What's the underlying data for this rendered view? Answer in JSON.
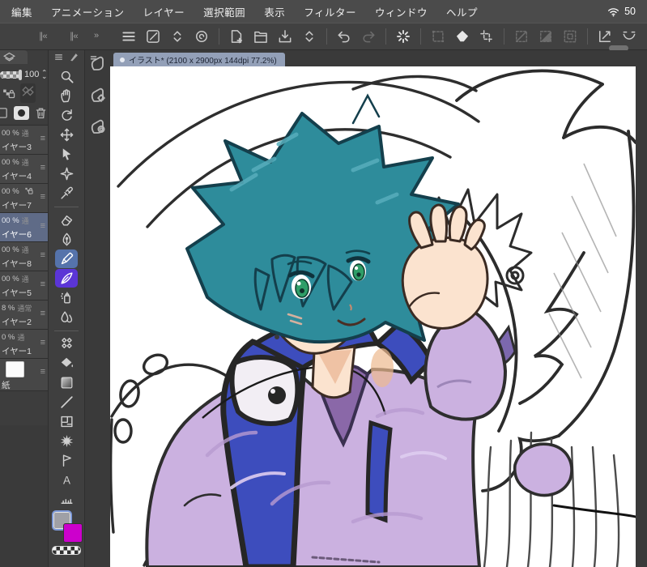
{
  "status": {
    "battery": "50"
  },
  "menu": {
    "items": [
      "編集",
      "アニメーション",
      "レイヤー",
      "選択範囲",
      "表示",
      "フィルター",
      "ウィンドウ",
      "ヘルプ"
    ]
  },
  "toolbar": {
    "collapse_left": "∥«",
    "collapse_mid": "∥«",
    "collapse_right": "»",
    "groups": [
      {
        "icons": [
          {
            "n": "main-menu"
          },
          {
            "n": "pen-settings"
          },
          {
            "n": "expand-chevrons"
          },
          {
            "n": "clip-studio"
          }
        ]
      },
      {
        "icons": [
          {
            "n": "new-canvas"
          },
          {
            "n": "open-file"
          },
          {
            "n": "save-file"
          },
          {
            "n": "expand-chevrons"
          }
        ]
      },
      {
        "icons": [
          {
            "n": "undo"
          },
          {
            "n": "redo",
            "disabled": true
          }
        ]
      },
      {
        "icons": [
          {
            "n": "sparkle",
            "bright": true
          }
        ]
      },
      {
        "icons": [
          {
            "n": "select-launcher",
            "disabled": true
          },
          {
            "n": "erase-diamond",
            "bright": true
          },
          {
            "n": "crop-frame"
          }
        ]
      },
      {
        "icons": [
          {
            "n": "deselect",
            "disabled": true
          },
          {
            "n": "invert-selection",
            "disabled": true
          },
          {
            "n": "border-selection",
            "disabled": true
          }
        ]
      },
      {
        "icons": [
          {
            "n": "snap-ruler"
          },
          {
            "n": "snap-curve"
          },
          {
            "n": "snap-special"
          }
        ]
      },
      {
        "icons": [
          {
            "n": "companion-mode"
          }
        ]
      },
      {
        "icons": [
          {
            "n": "help"
          }
        ]
      }
    ]
  },
  "doc_tab": {
    "title": "イラスト* (2100 x 2900px 144dpi 77.2%)"
  },
  "layers_panel": {
    "opacity_value": "100",
    "rows": [
      {
        "opacity": "00 %",
        "mode": "通",
        "name": "イヤー3"
      },
      {
        "opacity": "00 %",
        "mode": "通",
        "name": "イヤー4"
      },
      {
        "opacity": "00 %",
        "mode": "",
        "lock": true,
        "name": "イヤー7"
      },
      {
        "opacity": "00 %",
        "mode": "通",
        "name": "イヤー6",
        "selected": true
      },
      {
        "opacity": "00 %",
        "mode": "通",
        "name": "イヤー8"
      },
      {
        "opacity": "00 %",
        "mode": "通",
        "name": "イヤー5"
      },
      {
        "opacity": "8 %",
        "mode": "通常",
        "name": "イヤー2"
      },
      {
        "opacity": "0 %",
        "mode": "通",
        "name": "イヤー1"
      },
      {
        "paper": true,
        "name": "紙"
      }
    ]
  },
  "tools": {
    "items": [
      {
        "n": "zoom"
      },
      {
        "n": "hand"
      },
      {
        "n": "rotate"
      },
      {
        "n": "move"
      },
      {
        "n": "operate"
      },
      {
        "n": "auto-select"
      },
      {
        "n": "eyedropper"
      },
      {
        "sep": true
      },
      {
        "n": "eraser"
      },
      {
        "n": "pen"
      },
      {
        "n": "marker",
        "selected": true
      },
      {
        "n": "brush",
        "purple": true
      },
      {
        "n": "airbrush"
      },
      {
        "n": "blend"
      },
      {
        "sep": true
      },
      {
        "n": "decoration"
      },
      {
        "n": "fill"
      },
      {
        "n": "gradient"
      },
      {
        "n": "figure"
      },
      {
        "n": "frame"
      },
      {
        "n": "saturated-line"
      },
      {
        "n": "selection-pen"
      },
      {
        "n": "text"
      },
      {
        "n": "ruler"
      }
    ],
    "colors": {
      "main": "#9fa0a6",
      "sub": "#cc00cc"
    }
  },
  "quick_strip": {
    "items": [
      {
        "n": "hand-menu"
      },
      {
        "n": "hand-gear"
      },
      {
        "n": "hand-clip"
      }
    ]
  }
}
